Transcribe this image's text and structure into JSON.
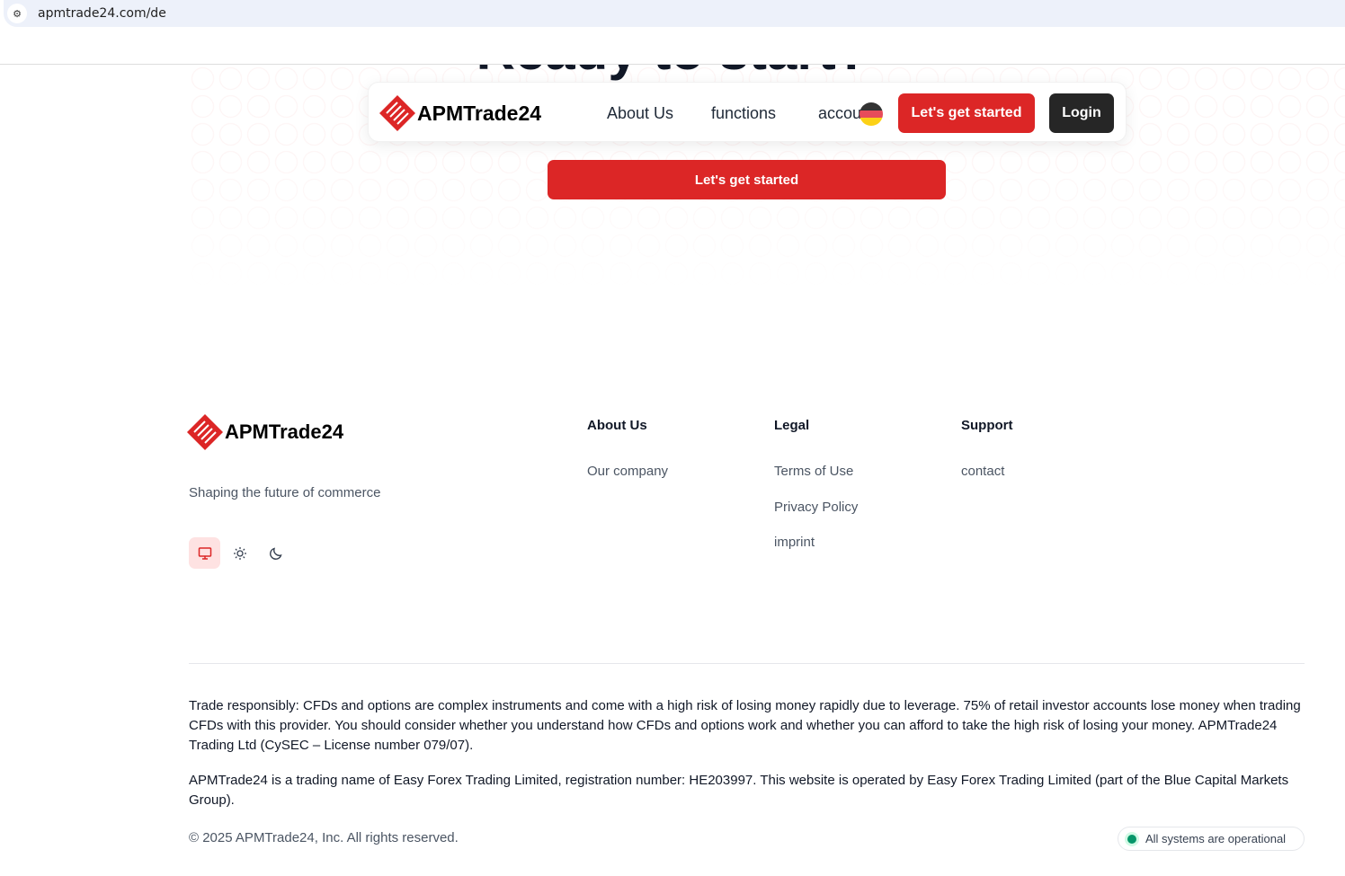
{
  "browser": {
    "url": "apmtrade24.com/de"
  },
  "hero": {
    "title": "Ready to start?",
    "cta": "Let's get started"
  },
  "nav": {
    "brand": "APMTrade24",
    "links": [
      "About Us",
      "functions",
      "accounts"
    ],
    "cta": "Let's get started",
    "login": "Login",
    "language": "de"
  },
  "footer": {
    "brand": "APMTrade24",
    "tagline": "Shaping the future of commerce",
    "theme_options": [
      "system",
      "light",
      "dark"
    ],
    "theme_selected": "system",
    "columns": [
      {
        "title": "About Us",
        "links": [
          "Our company"
        ]
      },
      {
        "title": "Legal",
        "links": [
          "Terms of Use",
          "Privacy Policy",
          "imprint"
        ]
      },
      {
        "title": "Support",
        "links": [
          "contact"
        ]
      }
    ],
    "disclaimer1": "Trade responsibly: CFDs and options are complex instruments and come with a high risk of losing money rapidly due to leverage. 75% of retail investor accounts lose money when trading CFDs with this provider. You should consider whether you understand how CFDs and options work and whether you can afford to take the high risk of losing your money. APMTrade24 Trading Ltd (CySEC – License number 079/07).",
    "disclaimer2": "APMTrade24 is a trading name of Easy Forex Trading Limited, registration number: HE203997. This website is operated by Easy Forex Trading Limited (part of the Blue Capital Markets Group).",
    "copyright": "© 2025 APMTrade24, Inc. All rights reserved.",
    "status": "All systems are operational"
  },
  "colors": {
    "accent": "#dc2626",
    "dark": "#262626",
    "status": "#059669"
  }
}
